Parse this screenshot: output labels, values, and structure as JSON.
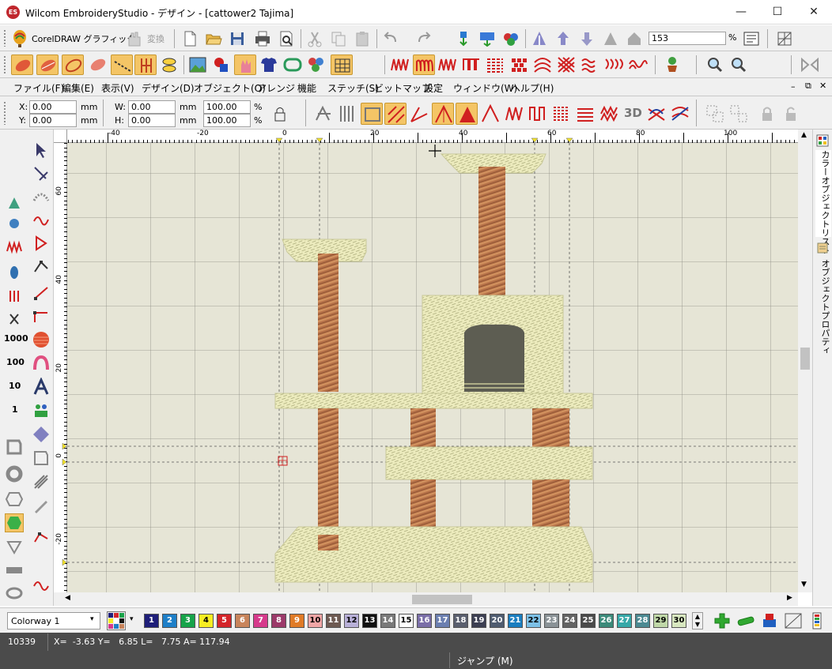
{
  "window": {
    "title": "Wilcom EmbroideryStudio - デザイン - [cattower2       Tajima]",
    "logo_text": "ES",
    "minimize_glyph": "—",
    "maximize_glyph": "☐",
    "close_glyph": "✕"
  },
  "toolbar_top": {
    "coreldraw_label": "CorelDRAW グラフィック",
    "convert_label": "変換",
    "zoom_value": "153",
    "zoom_unit": "%"
  },
  "menu": {
    "items": [
      "ファイル(F)",
      "編集(E)",
      "表示(V)",
      "デザイン(D)",
      "オブジェクト(O)",
      "アレンジ",
      "機能",
      "ステッチ(S)",
      "ビットマップ",
      "設定",
      "ウィンドウ(W)",
      "ヘルプ(H)"
    ]
  },
  "props": {
    "x_label": "X:",
    "x_value": "0.00",
    "x_unit": "mm",
    "y_label": "Y:",
    "y_value": "0.00",
    "y_unit": "mm",
    "w_label": "W:",
    "w_value": "0.00",
    "w_unit": "mm",
    "h_label": "H:",
    "h_value": "0.00",
    "h_unit": "mm",
    "sx_value": "100.00",
    "sx_unit": "%",
    "sy_value": "100.00",
    "sy_unit": "%",
    "threed_label": "3D"
  },
  "left_tools": {
    "stitch_1000": "1000",
    "stitch_100": "100",
    "stitch_10": "10",
    "stitch_1": "1"
  },
  "ruler": {
    "h_labels": [
      "-40",
      "-20",
      "0",
      "20",
      "40",
      "60",
      "80",
      "100"
    ],
    "v_labels": [
      "60",
      "40",
      "20",
      "0",
      "-20"
    ]
  },
  "right_panel": {
    "tab1": "カラーオブジェクトリスト",
    "tab2": "オブジェクトプロパティ"
  },
  "colorway": {
    "name": "Colorway 1",
    "chips": [
      {
        "n": "1",
        "c": "#1f1f7a",
        "t": "#fff"
      },
      {
        "n": "2",
        "c": "#1e7fc8",
        "t": "#fff"
      },
      {
        "n": "3",
        "c": "#17a34a",
        "t": "#fff"
      },
      {
        "n": "4",
        "c": "#f7ee22",
        "t": "#000"
      },
      {
        "n": "5",
        "c": "#d4252a",
        "t": "#fff"
      },
      {
        "n": "6",
        "c": "#c8845b",
        "t": "#fff"
      },
      {
        "n": "7",
        "c": "#d63a8c",
        "t": "#fff"
      },
      {
        "n": "8",
        "c": "#9c3a6a",
        "t": "#fff"
      },
      {
        "n": "9",
        "c": "#e07b27",
        "t": "#fff"
      },
      {
        "n": "10",
        "c": "#f2a6a6",
        "t": "#000"
      },
      {
        "n": "11",
        "c": "#6e5a52",
        "t": "#fff"
      },
      {
        "n": "12",
        "c": "#b8b0d8",
        "t": "#000"
      },
      {
        "n": "13",
        "c": "#111111",
        "t": "#fff"
      },
      {
        "n": "14",
        "c": "#7a7a7a",
        "t": "#fff"
      },
      {
        "n": "15",
        "c": "#ffffff",
        "t": "#000"
      },
      {
        "n": "16",
        "c": "#7a6ea8",
        "t": "#fff"
      },
      {
        "n": "17",
        "c": "#6b7fb0",
        "t": "#fff"
      },
      {
        "n": "18",
        "c": "#5a5f6e",
        "t": "#fff"
      },
      {
        "n": "19",
        "c": "#3c3f52",
        "t": "#fff"
      },
      {
        "n": "20",
        "c": "#4f5c70",
        "t": "#fff"
      },
      {
        "n": "21",
        "c": "#1a7ec0",
        "t": "#fff"
      },
      {
        "n": "22",
        "c": "#7cc0e6",
        "t": "#000"
      },
      {
        "n": "23",
        "c": "#8a9296",
        "t": "#fff"
      },
      {
        "n": "24",
        "c": "#646464",
        "t": "#fff"
      },
      {
        "n": "25",
        "c": "#4a4a4a",
        "t": "#fff"
      },
      {
        "n": "26",
        "c": "#3b8a7a",
        "t": "#fff"
      },
      {
        "n": "27",
        "c": "#36a8a8",
        "t": "#fff"
      },
      {
        "n": "28",
        "c": "#4c8a92",
        "t": "#fff"
      },
      {
        "n": "29",
        "c": "#c0d8a8",
        "t": "#000"
      },
      {
        "n": "30",
        "c": "#d8e8c0",
        "t": "#000"
      }
    ]
  },
  "status": {
    "stitch_count": "10339",
    "coords": "X=  -3.63 Y=   6.85 L=   7.75 A= 117.94"
  },
  "bottom": {
    "jump_label": "ジャンプ (M)"
  },
  "colors": {
    "canvas_bg": "#e6e5d6",
    "platform": "#ecebbd",
    "post": "#b8734a",
    "toolbar": "#f0f0f0",
    "dark_bar": "#4b4b4b"
  }
}
